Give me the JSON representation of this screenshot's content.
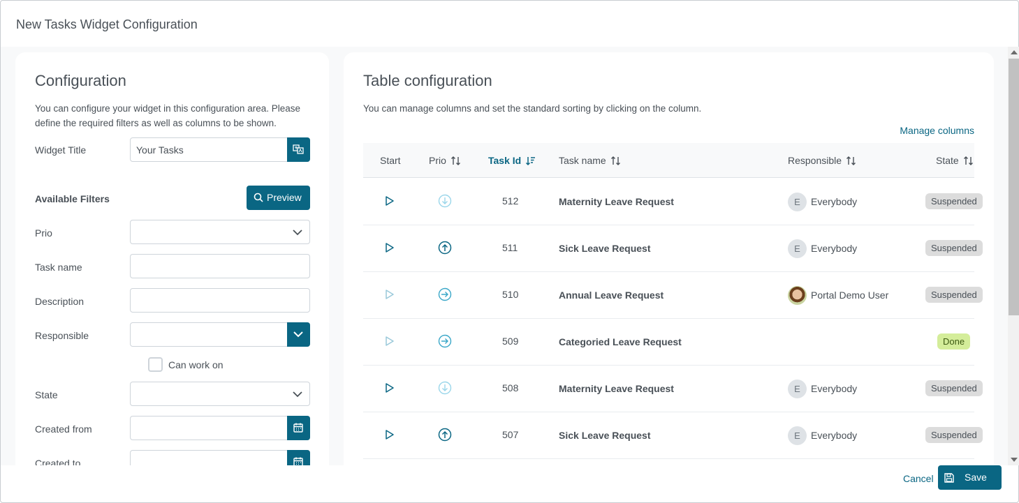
{
  "dialog": {
    "title": "New Tasks Widget Configuration"
  },
  "config": {
    "title": "Configuration",
    "description": "You can configure your widget in this configuration area. Please define the required filters as well as columns to be shown.",
    "widget_title_label": "Widget Title",
    "widget_title_value": "Your Tasks",
    "filters_title": "Available Filters",
    "preview_label": "Preview",
    "filters": {
      "prio": "Prio",
      "task_name": "Task name",
      "description": "Description",
      "responsible": "Responsible",
      "can_work_on": "Can work on",
      "state": "State",
      "created_from": "Created from",
      "created_to": "Created to"
    }
  },
  "table_config": {
    "title": "Table configuration",
    "description": "You can manage columns and set the standard sorting by clicking on the column.",
    "manage_columns": "Manage columns",
    "columns": {
      "start": "Start",
      "prio": "Prio",
      "task_id": "Task Id",
      "task_name": "Task name",
      "responsible": "Responsible",
      "state": "State"
    },
    "rows": [
      {
        "id": "512",
        "name": "Maternity Leave Request",
        "prio": "low",
        "start_active": true,
        "avatar": "E",
        "responsible": "Everybody",
        "state": "Suspended"
      },
      {
        "id": "511",
        "name": "Sick Leave Request",
        "prio": "high",
        "start_active": true,
        "avatar": "E",
        "responsible": "Everybody",
        "state": "Suspended"
      },
      {
        "id": "510",
        "name": "Annual Leave Request",
        "prio": "normal",
        "start_active": false,
        "avatar": "",
        "responsible": "Portal Demo User",
        "state": "Suspended"
      },
      {
        "id": "509",
        "name": "Categoried Leave Request",
        "prio": "normal",
        "start_active": false,
        "avatar": "",
        "responsible": "",
        "state": "Done"
      },
      {
        "id": "508",
        "name": "Maternity Leave Request",
        "prio": "low",
        "start_active": true,
        "avatar": "E",
        "responsible": "Everybody",
        "state": "Suspended"
      },
      {
        "id": "507",
        "name": "Sick Leave Request",
        "prio": "high",
        "start_active": true,
        "avatar": "E",
        "responsible": "Everybody",
        "state": "Suspended"
      }
    ]
  },
  "footer": {
    "cancel": "Cancel",
    "save": "Save"
  },
  "colors": {
    "primary": "#0a6683",
    "badge_suspended": "#dcdcdc",
    "badge_done": "#d4ed9a"
  }
}
